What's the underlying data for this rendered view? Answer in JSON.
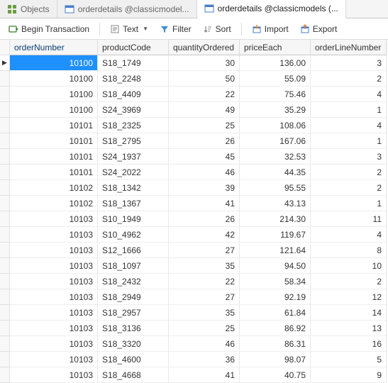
{
  "tabs": [
    {
      "label": "Objects",
      "active": false,
      "icon": "grid"
    },
    {
      "label": "orderdetails @classicmodel...",
      "active": false,
      "icon": "table"
    },
    {
      "label": "orderdetails @classicmodels (...",
      "active": true,
      "icon": "table"
    }
  ],
  "toolbar": {
    "begin": "Begin Transaction",
    "text": "Text",
    "filter": "Filter",
    "sort": "Sort",
    "import": "Import",
    "export": "Export"
  },
  "columns": [
    {
      "key": "orderNumber",
      "label": "orderNumber",
      "align": "num",
      "sort": true
    },
    {
      "key": "productCode",
      "label": "productCode",
      "align": "",
      "sort": false
    },
    {
      "key": "quantityOrdered",
      "label": "quantityOrdered",
      "align": "num",
      "sort": false
    },
    {
      "key": "priceEach",
      "label": "priceEach",
      "align": "num",
      "sort": false
    },
    {
      "key": "orderLineNumber",
      "label": "orderLineNumber",
      "align": "num",
      "sort": false
    }
  ],
  "rows": [
    {
      "orderNumber": 10100,
      "productCode": "S18_1749",
      "quantityOrdered": 30,
      "priceEach": "136.00",
      "orderLineNumber": 3,
      "sel": true
    },
    {
      "orderNumber": 10100,
      "productCode": "S18_2248",
      "quantityOrdered": 50,
      "priceEach": "55.09",
      "orderLineNumber": 2
    },
    {
      "orderNumber": 10100,
      "productCode": "S18_4409",
      "quantityOrdered": 22,
      "priceEach": "75.46",
      "orderLineNumber": 4
    },
    {
      "orderNumber": 10100,
      "productCode": "S24_3969",
      "quantityOrdered": 49,
      "priceEach": "35.29",
      "orderLineNumber": 1
    },
    {
      "orderNumber": 10101,
      "productCode": "S18_2325",
      "quantityOrdered": 25,
      "priceEach": "108.06",
      "orderLineNumber": 4
    },
    {
      "orderNumber": 10101,
      "productCode": "S18_2795",
      "quantityOrdered": 26,
      "priceEach": "167.06",
      "orderLineNumber": 1
    },
    {
      "orderNumber": 10101,
      "productCode": "S24_1937",
      "quantityOrdered": 45,
      "priceEach": "32.53",
      "orderLineNumber": 3
    },
    {
      "orderNumber": 10101,
      "productCode": "S24_2022",
      "quantityOrdered": 46,
      "priceEach": "44.35",
      "orderLineNumber": 2
    },
    {
      "orderNumber": 10102,
      "productCode": "S18_1342",
      "quantityOrdered": 39,
      "priceEach": "95.55",
      "orderLineNumber": 2
    },
    {
      "orderNumber": 10102,
      "productCode": "S18_1367",
      "quantityOrdered": 41,
      "priceEach": "43.13",
      "orderLineNumber": 1
    },
    {
      "orderNumber": 10103,
      "productCode": "S10_1949",
      "quantityOrdered": 26,
      "priceEach": "214.30",
      "orderLineNumber": 11
    },
    {
      "orderNumber": 10103,
      "productCode": "S10_4962",
      "quantityOrdered": 42,
      "priceEach": "119.67",
      "orderLineNumber": 4
    },
    {
      "orderNumber": 10103,
      "productCode": "S12_1666",
      "quantityOrdered": 27,
      "priceEach": "121.64",
      "orderLineNumber": 8
    },
    {
      "orderNumber": 10103,
      "productCode": "S18_1097",
      "quantityOrdered": 35,
      "priceEach": "94.50",
      "orderLineNumber": 10
    },
    {
      "orderNumber": 10103,
      "productCode": "S18_2432",
      "quantityOrdered": 22,
      "priceEach": "58.34",
      "orderLineNumber": 2
    },
    {
      "orderNumber": 10103,
      "productCode": "S18_2949",
      "quantityOrdered": 27,
      "priceEach": "92.19",
      "orderLineNumber": 12
    },
    {
      "orderNumber": 10103,
      "productCode": "S18_2957",
      "quantityOrdered": 35,
      "priceEach": "61.84",
      "orderLineNumber": 14
    },
    {
      "orderNumber": 10103,
      "productCode": "S18_3136",
      "quantityOrdered": 25,
      "priceEach": "86.92",
      "orderLineNumber": 13
    },
    {
      "orderNumber": 10103,
      "productCode": "S18_3320",
      "quantityOrdered": 46,
      "priceEach": "86.31",
      "orderLineNumber": 16
    },
    {
      "orderNumber": 10103,
      "productCode": "S18_4600",
      "quantityOrdered": 36,
      "priceEach": "98.07",
      "orderLineNumber": 5
    },
    {
      "orderNumber": 10103,
      "productCode": "S18_4668",
      "quantityOrdered": 41,
      "priceEach": "40.75",
      "orderLineNumber": 9
    }
  ]
}
